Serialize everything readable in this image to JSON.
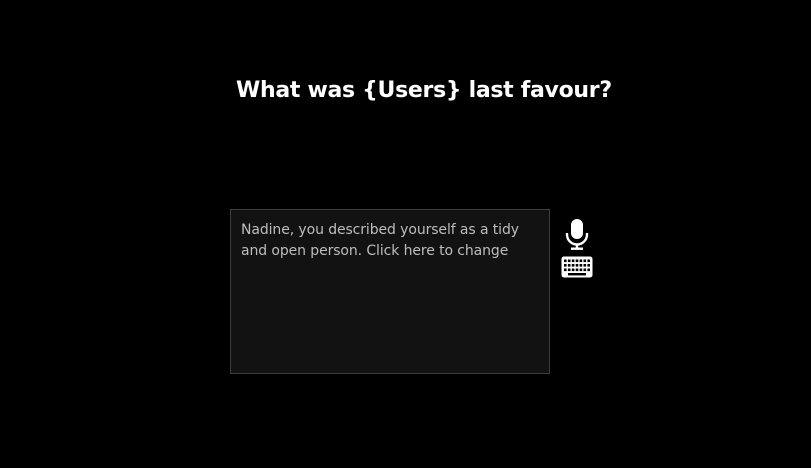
{
  "question": {
    "text": "What was {Users} last favour?"
  },
  "answer": {
    "text": "Nadine, you described yourself as a tidy and open person. Click here to change"
  },
  "controls": {
    "mic_icon": "microphone-icon",
    "keyboard_icon": "keyboard-icon",
    "icon_color": "#ffffff"
  },
  "colors": {
    "background": "#000000",
    "box_background": "#121212",
    "box_border": "#3c3c3c",
    "question_text": "#ffffff",
    "answer_text": "#bdbdbd"
  }
}
